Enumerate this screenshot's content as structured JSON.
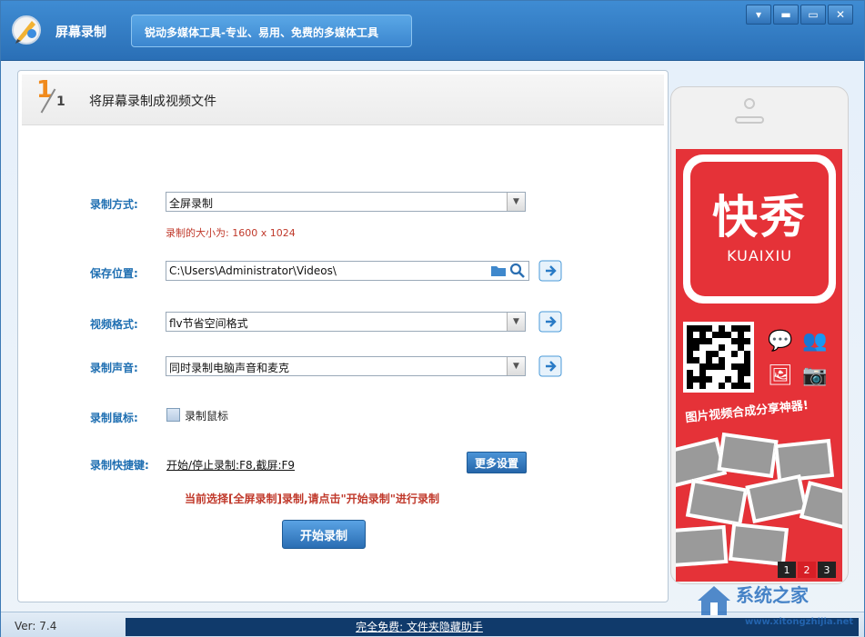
{
  "app": {
    "title": "屏幕录制",
    "slogan": "锐动多媒体工具-专业、易用、免费的多媒体工具",
    "window_controls": {
      "minimize_glyph": "▬",
      "restore_glyph": "▭",
      "close_glyph": "✕"
    }
  },
  "step": {
    "current": "1",
    "total": "1",
    "title": "将屏幕录制成视频文件"
  },
  "form": {
    "mode": {
      "label": "录制方式:",
      "value": "全屏录制"
    },
    "size_note": "录制的大小为: 1600 x 1024",
    "save": {
      "label": "保存位置:",
      "value": "C:\\Users\\Administrator\\Videos\\"
    },
    "format": {
      "label": "视频格式:",
      "value": "flv节省空间格式"
    },
    "audio": {
      "label": "录制声音:",
      "value": "同时录制电脑声音和麦克"
    },
    "mouse": {
      "label": "录制鼠标:",
      "checkbox_label": "录制鼠标",
      "checked": false
    },
    "hotkey": {
      "label": "录制快捷键:",
      "value": "开始/停止录制:F8,截屏:F9"
    },
    "more_settings": "更多设置",
    "hint": "当前选择[全屏录制]录制,请点击\"开始录制\"进行录制",
    "start_button": "开始录制"
  },
  "ad": {
    "brand_cn": "快秀",
    "brand_en": "KUAIXIU",
    "slogan": "图片视频合成分享神器!",
    "pages": [
      "1",
      "2",
      "3"
    ],
    "active_page": "2",
    "colors": {
      "background": "#e53238",
      "active_page": "#d71f26"
    }
  },
  "status": {
    "version": "Ver: 7.4",
    "link": "完全免费: 文件夹隐藏助手"
  },
  "watermark": {
    "text": "系统之家",
    "url": "www.xitongzhijia.net"
  },
  "colors": {
    "title_bar": "#2f76bd",
    "label": "#1f6fb2",
    "warning": "#c0392b",
    "button": "#2a6db3"
  }
}
